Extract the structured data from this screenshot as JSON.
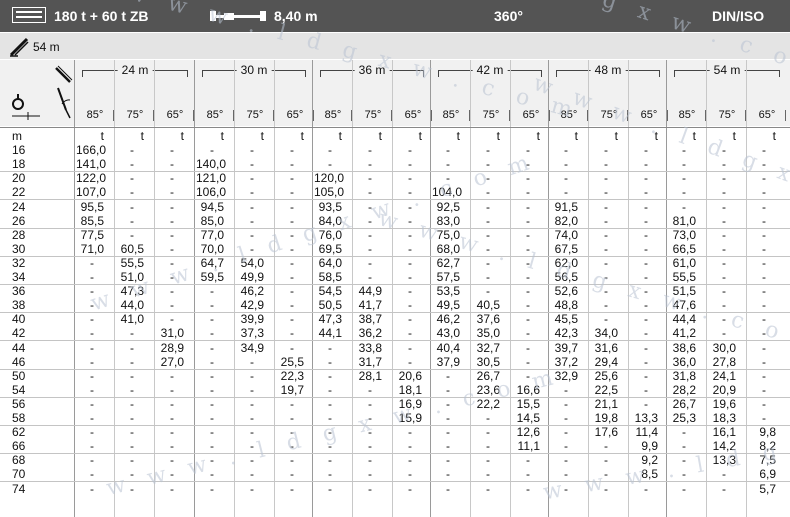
{
  "topbar": {
    "counterweight": "180 t + 60 t ZB",
    "outrigger_span": "8,40 m",
    "slew_range": "360°",
    "standard": "DIN/ISO"
  },
  "boom": {
    "main_boom_length": "54 m"
  },
  "columns": [
    "24 m",
    "30 m",
    "36 m",
    "42 m",
    "48 m",
    "54 m"
  ],
  "angles": [
    "85°",
    "75°",
    "65°"
  ],
  "radius_unit": "m",
  "load_unit": "t",
  "rows": [
    {
      "r": "16",
      "v": [
        "166,0",
        "-",
        "-",
        "-",
        "-",
        "-",
        "-",
        "-",
        "-",
        "-",
        "-",
        "-",
        "-",
        "-",
        "-",
        "-",
        "-",
        "-"
      ]
    },
    {
      "r": "18",
      "v": [
        "141,0",
        "-",
        "-",
        "140,0",
        "-",
        "-",
        "-",
        "-",
        "-",
        "-",
        "-",
        "-",
        "-",
        "-",
        "-",
        "-",
        "-",
        "-"
      ]
    },
    {
      "r": "20",
      "v": [
        "122,0",
        "-",
        "-",
        "121,0",
        "-",
        "-",
        "120,0",
        "-",
        "-",
        "-",
        "-",
        "-",
        "-",
        "-",
        "-",
        "-",
        "-",
        "-"
      ]
    },
    {
      "r": "22",
      "v": [
        "107,0",
        "-",
        "-",
        "106,0",
        "-",
        "-",
        "105,0",
        "-",
        "-",
        "104,0",
        "-",
        "-",
        "-",
        "-",
        "-",
        "-",
        "-",
        "-"
      ]
    },
    {
      "r": "24",
      "v": [
        "95,5",
        "-",
        "-",
        "94,5",
        "-",
        "-",
        "93,5",
        "-",
        "-",
        "92,5",
        "-",
        "-",
        "91,5",
        "-",
        "-",
        "-",
        "-",
        "-"
      ]
    },
    {
      "r": "26",
      "v": [
        "85,5",
        "-",
        "-",
        "85,0",
        "-",
        "-",
        "84,0",
        "-",
        "-",
        "83,0",
        "-",
        "-",
        "82,0",
        "-",
        "-",
        "81,0",
        "-",
        "-"
      ]
    },
    {
      "r": "28",
      "v": [
        "77,5",
        "-",
        "-",
        "77,0",
        "-",
        "-",
        "76,0",
        "-",
        "-",
        "75,0",
        "-",
        "-",
        "74,0",
        "-",
        "-",
        "73,0",
        "-",
        "-"
      ]
    },
    {
      "r": "30",
      "v": [
        "71,0",
        "60,5",
        "-",
        "70,0",
        "-",
        "-",
        "69,5",
        "-",
        "-",
        "68,0",
        "-",
        "-",
        "67,5",
        "-",
        "-",
        "66,5",
        "-",
        "-"
      ]
    },
    {
      "r": "32",
      "v": [
        "-",
        "55,5",
        "-",
        "64,7",
        "54,0",
        "-",
        "64,0",
        "-",
        "-",
        "62,7",
        "-",
        "-",
        "62,0",
        "-",
        "-",
        "61,0",
        "-",
        "-"
      ]
    },
    {
      "r": "34",
      "v": [
        "-",
        "51,0",
        "-",
        "59,5",
        "49,9",
        "-",
        "58,5",
        "-",
        "-",
        "57,5",
        "-",
        "-",
        "56,5",
        "-",
        "-",
        "55,5",
        "-",
        "-"
      ]
    },
    {
      "r": "36",
      "v": [
        "-",
        "47,3",
        "-",
        "-",
        "46,2",
        "-",
        "54,5",
        "44,9",
        "-",
        "53,5",
        "-",
        "-",
        "52,6",
        "-",
        "-",
        "51,5",
        "-",
        "-"
      ]
    },
    {
      "r": "38",
      "v": [
        "-",
        "44,0",
        "-",
        "-",
        "42,9",
        "-",
        "50,5",
        "41,7",
        "-",
        "49,5",
        "40,5",
        "-",
        "48,8",
        "-",
        "-",
        "47,6",
        "-",
        "-"
      ]
    },
    {
      "r": "40",
      "v": [
        "-",
        "41,0",
        "-",
        "-",
        "39,9",
        "-",
        "47,3",
        "38,7",
        "-",
        "46,2",
        "37,6",
        "-",
        "45,5",
        "-",
        "-",
        "44,4",
        "-",
        "-"
      ]
    },
    {
      "r": "42",
      "v": [
        "-",
        "-",
        "31,0",
        "-",
        "37,3",
        "-",
        "44,1",
        "36,2",
        "-",
        "43,0",
        "35,0",
        "-",
        "42,3",
        "34,0",
        "-",
        "41,2",
        "-",
        "-"
      ]
    },
    {
      "r": "44",
      "v": [
        "-",
        "-",
        "28,9",
        "-",
        "34,9",
        "-",
        "-",
        "33,8",
        "-",
        "40,4",
        "32,7",
        "-",
        "39,7",
        "31,6",
        "-",
        "38,6",
        "30,0",
        "-"
      ]
    },
    {
      "r": "46",
      "v": [
        "-",
        "-",
        "27,0",
        "-",
        "-",
        "25,5",
        "-",
        "31,7",
        "-",
        "37,9",
        "30,5",
        "-",
        "37,2",
        "29,4",
        "-",
        "36,0",
        "27,8",
        "-"
      ]
    },
    {
      "r": "50",
      "v": [
        "-",
        "-",
        "-",
        "-",
        "-",
        "22,3",
        "-",
        "28,1",
        "20,6",
        "-",
        "26,7",
        "-",
        "32,9",
        "25,6",
        "-",
        "31,8",
        "24,1",
        "-"
      ]
    },
    {
      "r": "54",
      "v": [
        "-",
        "-",
        "-",
        "-",
        "-",
        "19,7",
        "-",
        "-",
        "18,1",
        "-",
        "23,6",
        "16,6",
        "-",
        "22,5",
        "-",
        "28,2",
        "20,9",
        "-"
      ]
    },
    {
      "r": "56",
      "v": [
        "-",
        "-",
        "-",
        "-",
        "-",
        "-",
        "-",
        "-",
        "16,9",
        "-",
        "22,2",
        "15,5",
        "-",
        "21,1",
        "-",
        "26,7",
        "19,6",
        "-"
      ]
    },
    {
      "r": "58",
      "v": [
        "-",
        "-",
        "-",
        "-",
        "-",
        "-",
        "-",
        "-",
        "15,9",
        "-",
        "-",
        "14,5",
        "-",
        "19,8",
        "13,3",
        "25,3",
        "18,3",
        "-"
      ]
    },
    {
      "r": "62",
      "v": [
        "-",
        "-",
        "-",
        "-",
        "-",
        "-",
        "-",
        "-",
        "-",
        "-",
        "-",
        "12,6",
        "-",
        "17,6",
        "11,4",
        "-",
        "16,1",
        "9,8"
      ]
    },
    {
      "r": "66",
      "v": [
        "-",
        "-",
        "-",
        "-",
        "-",
        "-",
        "-",
        "-",
        "-",
        "-",
        "-",
        "11,1",
        "-",
        "-",
        "9,9",
        "-",
        "14,2",
        "8,2"
      ]
    },
    {
      "r": "68",
      "v": [
        "-",
        "-",
        "-",
        "-",
        "-",
        "-",
        "-",
        "-",
        "-",
        "-",
        "-",
        "-",
        "-",
        "-",
        "9,2",
        "-",
        "13,3",
        "7,5"
      ]
    },
    {
      "r": "70",
      "v": [
        "-",
        "-",
        "-",
        "-",
        "-",
        "-",
        "-",
        "-",
        "-",
        "-",
        "-",
        "-",
        "-",
        "-",
        "8,5",
        "-",
        "-",
        "6,9"
      ]
    },
    {
      "r": "74",
      "v": [
        "-",
        "-",
        "-",
        "-",
        "-",
        "-",
        "-",
        "-",
        "-",
        "-",
        "-",
        "-",
        "-",
        "-",
        "-",
        "-",
        "-",
        "5,7"
      ]
    }
  ],
  "watermark": "w w w . l d g x w . c o m"
}
